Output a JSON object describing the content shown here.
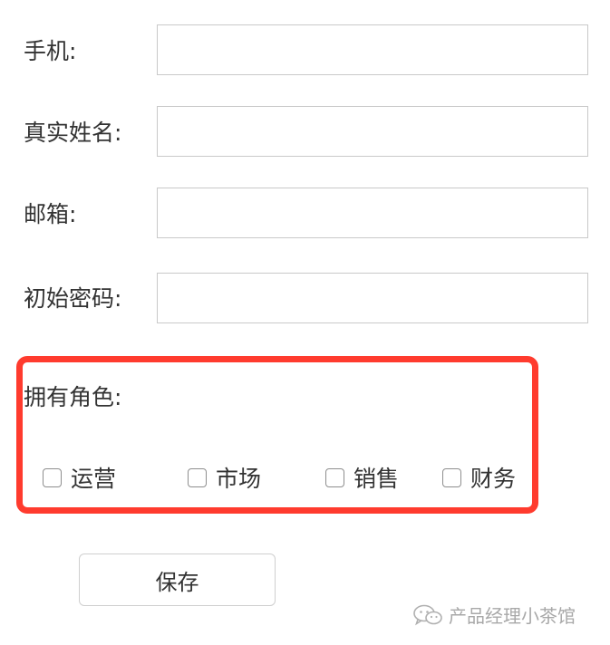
{
  "form": {
    "fields": [
      {
        "label": "手机:",
        "value": ""
      },
      {
        "label": "真实姓名:",
        "value": ""
      },
      {
        "label": "邮箱:",
        "value": ""
      },
      {
        "label": "初始密码:",
        "value": ""
      }
    ],
    "roles": {
      "label": "拥有角色:",
      "options": [
        {
          "label": "运营",
          "checked": false
        },
        {
          "label": "市场",
          "checked": false
        },
        {
          "label": "销售",
          "checked": false
        },
        {
          "label": "财务",
          "checked": false
        }
      ],
      "highlight_color": "#ff3b2e"
    },
    "save_label": "保存"
  },
  "watermark": {
    "icon": "wechat-icon",
    "text": "产品经理小茶馆"
  }
}
